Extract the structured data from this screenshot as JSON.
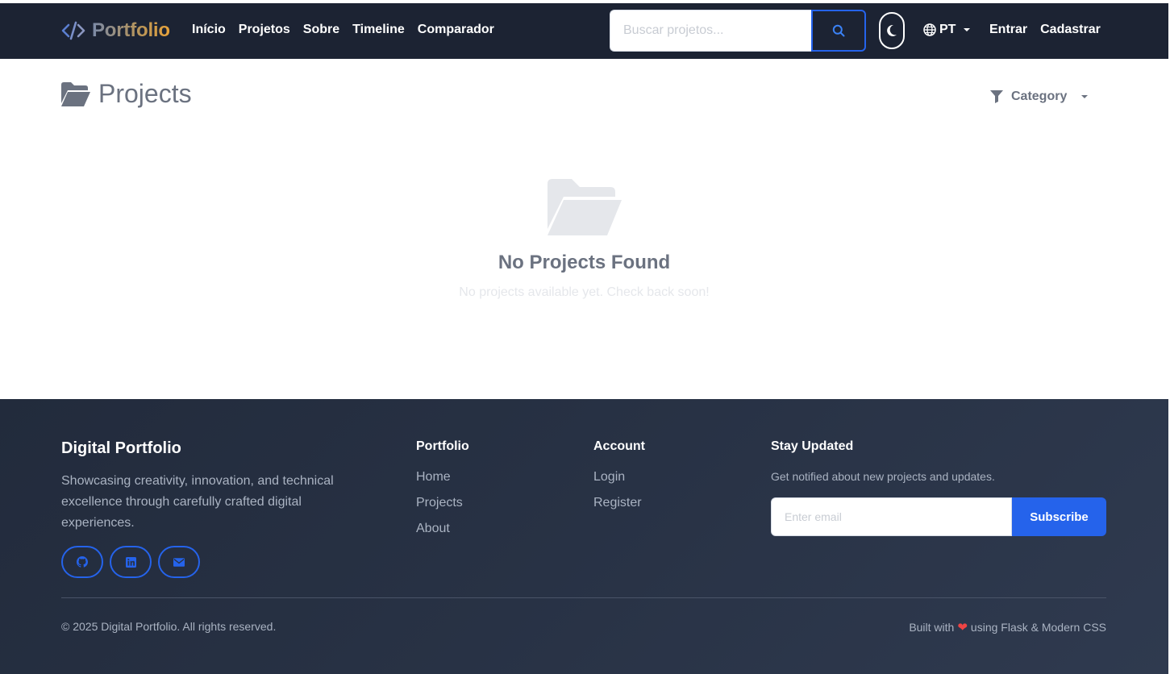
{
  "navbar": {
    "brand": "Portfolio",
    "links": [
      "Início",
      "Projetos",
      "Sobre",
      "Timeline",
      "Comparador"
    ],
    "search_placeholder": "Buscar projetos...",
    "language": "PT",
    "login": "Entrar",
    "register": "Cadastrar"
  },
  "main": {
    "title": "Projects",
    "category_filter": "Category",
    "empty_title": "No Projects Found",
    "empty_subtitle": "No projects available yet. Check back soon!"
  },
  "footer": {
    "brand": "Digital Portfolio",
    "description": "Showcasing creativity, innovation, and technical excellence through carefully crafted digital experiences.",
    "socials": [
      "github-icon",
      "linkedin-icon",
      "mail-icon"
    ],
    "portfolio": {
      "heading": "Portfolio",
      "links": [
        "Home",
        "Projects",
        "About"
      ]
    },
    "account": {
      "heading": "Account",
      "links": [
        "Login",
        "Register"
      ]
    },
    "newsletter": {
      "heading": "Stay Updated",
      "text": "Get notified about new projects and updates.",
      "placeholder": "Enter email",
      "button": "Subscribe"
    },
    "copyright": "© 2025 Digital Portfolio. All rights reserved.",
    "built_prefix": "Built with",
    "built_suffix": "using Flask & Modern CSS"
  },
  "colors": {
    "navbar_bg": "#1c2333",
    "accent": "#2563eb",
    "footer_bg": "#283245",
    "heart": "#ef4444"
  }
}
